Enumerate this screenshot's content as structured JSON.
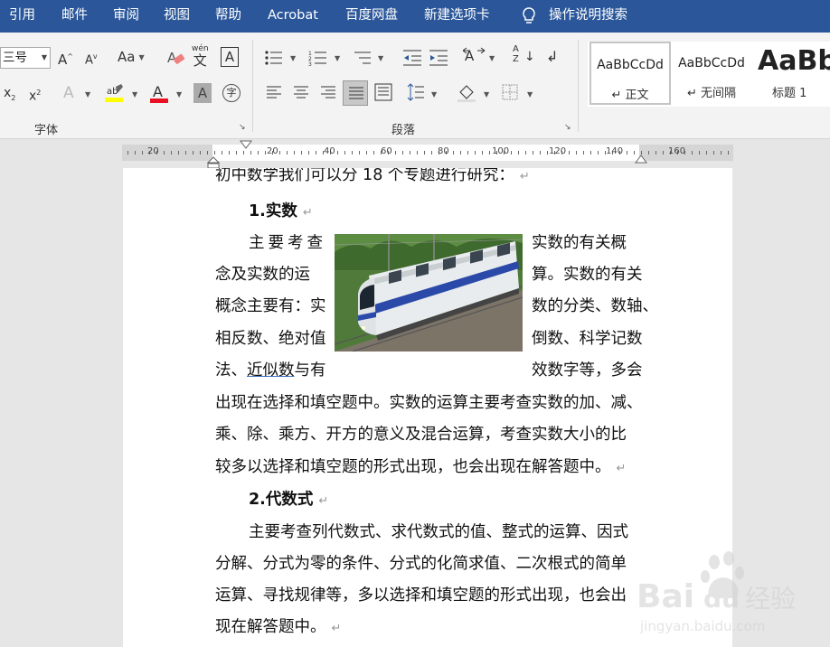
{
  "menu": {
    "items": [
      "引用",
      "邮件",
      "审阅",
      "视图",
      "帮助",
      "Acrobat",
      "百度网盘",
      "新建选项卡"
    ],
    "search_label": "操作说明搜索"
  },
  "ribbon": {
    "font": {
      "size_value": "三号",
      "group_label": "字体",
      "case_label": "Aa",
      "phonetic_top": "wén",
      "phonetic_bottom": "文",
      "border_char": "A",
      "enclose_char": "字"
    },
    "paragraph": {
      "group_label": "段落"
    },
    "styles": {
      "items": [
        {
          "sample": "AaBbCcDd",
          "name": "↵ 正文"
        },
        {
          "sample": "AaBbCcDd",
          "name": "↵ 无间隔"
        },
        {
          "sample": "AaBb",
          "name": "标题 1"
        }
      ]
    }
  },
  "ruler": {
    "labels": [
      "20",
      "20",
      "40",
      "60",
      "80",
      "100",
      "120",
      "140",
      "160"
    ]
  },
  "document": {
    "intro": "初中数学我们可以分 18 个专题进行研究：",
    "h1": "1.实数",
    "p1": {
      "l1_left": "主要考查",
      "l1_right": "实数的有关概",
      "l2_left": "念及实数的运",
      "l2_right": "算。实数的有关",
      "l3_left": "概念主要有：实",
      "l3_right": "数的分类、数轴、",
      "l4_left": "相反数、绝对值",
      "l4_right": "倒数、科学记数",
      "l5_left_a": "法、",
      "l5_link": "近似数",
      "l5_left_b": "与有",
      "l5_right": "效数字等，多会",
      "l6": "出现在选择和填空题中。实数的运算主要考查实数的加、减、",
      "l7": "乘、除、乘方、开方的意义及混合运算，考查实数大小的比",
      "l8": "较多以选择和填空题的形式出现，也会出现在解答题中。"
    },
    "h2": "2.代数式",
    "p2": {
      "l1": "主要考查列代数式、求代数式的值、整式的运算、因式",
      "l2": "分解、分式为零的条件、分式的化简求值、二次根式的简单",
      "l3": "运算、寻找规律等，多以选择和填空题的形式出现，也会出",
      "l4": "现在解答题中。"
    },
    "para_mark": "↵"
  },
  "watermark": {
    "brand": "Bai",
    "brand2": "du",
    "cn": "经验",
    "url": "jingyan.baidu.com"
  },
  "colors": {
    "menubar": "#2b579a",
    "highlight": "#ffff00",
    "font_color": "#e81123"
  }
}
